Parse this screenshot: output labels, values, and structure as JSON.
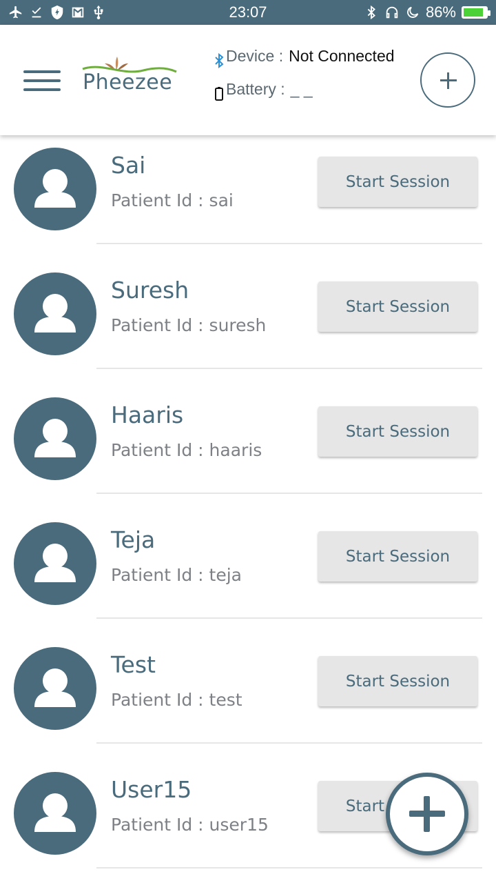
{
  "status_bar": {
    "time": "23:07",
    "battery_percent": "86%",
    "battery_level": 0.86,
    "left_icons": [
      "airplane-icon",
      "download-done-icon",
      "shield-icon",
      "gmail-icon",
      "usb-icon"
    ],
    "right_icons": [
      "bluetooth-icon",
      "headset-icon",
      "moon-icon"
    ]
  },
  "header": {
    "logo_text": "Pheezee",
    "device_label": "Device :",
    "device_value": "Not Connected",
    "battery_label": "Battery :",
    "battery_value": "_ _",
    "colors": {
      "primary": "#4a6b7c",
      "logo_leaf": "#b07a50",
      "logo_wave": "#6fae3e"
    }
  },
  "patients": [
    {
      "name": "Sai",
      "id_label": "Patient Id : sai",
      "button": "Start Session"
    },
    {
      "name": "Suresh",
      "id_label": "Patient Id : suresh",
      "button": "Start Session"
    },
    {
      "name": "Haaris",
      "id_label": "Patient Id : haaris",
      "button": "Start Session"
    },
    {
      "name": "Teja",
      "id_label": "Patient Id : teja",
      "button": "Start Session"
    },
    {
      "name": "Test",
      "id_label": "Patient Id : test",
      "button": "Start Session"
    },
    {
      "name": "User15",
      "id_label": "Patient Id : user15",
      "button": "Start Session"
    }
  ]
}
